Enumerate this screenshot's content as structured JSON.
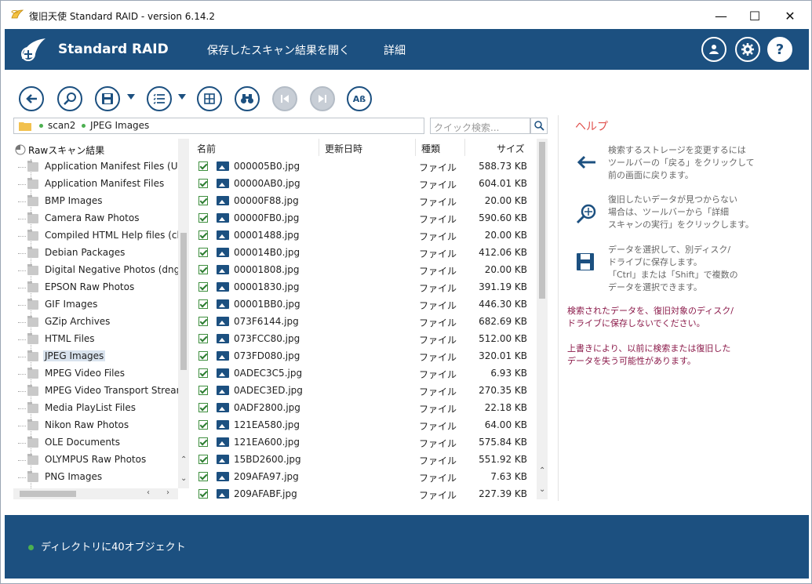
{
  "window": {
    "title": "復旧天使 Standard RAID - version 6.14.2",
    "minimize": "—",
    "maximize": "☐",
    "close": "✕"
  },
  "header": {
    "brand": "Standard RAID",
    "menu": [
      "保存したスキャン結果を開く",
      "詳細"
    ],
    "icons": [
      "user-icon",
      "gear-icon",
      "help-icon"
    ]
  },
  "path": {
    "crumbs": [
      "scan2",
      "JPEG Images"
    ]
  },
  "search": {
    "placeholder": "クイック検索..."
  },
  "tree": {
    "root": "Rawスキャン結果",
    "items": [
      "Application Manifest Files (Un",
      "Application Manifest Files",
      "BMP Images",
      "Camera Raw Photos",
      "Compiled HTML Help files (ch",
      "Debian Packages",
      "Digital Negative Photos (dng)",
      "EPSON Raw Photos",
      "GIF Images",
      "GZip Archives",
      "HTML Files",
      "JPEG Images",
      "MPEG Video Files",
      "MPEG Video Transport Stream",
      "Media PlayList Files",
      "Nikon Raw Photos",
      "OLE Documents",
      "OLYMPUS Raw Photos",
      "PNG Images"
    ],
    "selected": "JPEG Images"
  },
  "list": {
    "columns": [
      "名前",
      "更新日時",
      "種類",
      "サイズ"
    ],
    "rows": [
      {
        "name": "000005B0.jpg",
        "type": "ファイル",
        "size": "588.73 KB"
      },
      {
        "name": "00000AB0.jpg",
        "type": "ファイル",
        "size": "604.01 KB"
      },
      {
        "name": "00000F88.jpg",
        "type": "ファイル",
        "size": "20.00 KB"
      },
      {
        "name": "00000FB0.jpg",
        "type": "ファイル",
        "size": "590.60 KB"
      },
      {
        "name": "00001488.jpg",
        "type": "ファイル",
        "size": "20.00 KB"
      },
      {
        "name": "000014B0.jpg",
        "type": "ファイル",
        "size": "412.06 KB"
      },
      {
        "name": "00001808.jpg",
        "type": "ファイル",
        "size": "20.00 KB"
      },
      {
        "name": "00001830.jpg",
        "type": "ファイル",
        "size": "391.19 KB"
      },
      {
        "name": "00001BB0.jpg",
        "type": "ファイル",
        "size": "446.30 KB"
      },
      {
        "name": "073F6144.jpg",
        "type": "ファイル",
        "size": "682.69 KB"
      },
      {
        "name": "073FCC80.jpg",
        "type": "ファイル",
        "size": "512.00 KB"
      },
      {
        "name": "073FD080.jpg",
        "type": "ファイル",
        "size": "320.01 KB"
      },
      {
        "name": "0ADEC3C5.jpg",
        "type": "ファイル",
        "size": "6.93 KB"
      },
      {
        "name": "0ADEC3ED.jpg",
        "type": "ファイル",
        "size": "270.35 KB"
      },
      {
        "name": "0ADF2800.jpg",
        "type": "ファイル",
        "size": "22.18 KB"
      },
      {
        "name": "121EA580.jpg",
        "type": "ファイル",
        "size": "64.00 KB"
      },
      {
        "name": "121EA600.jpg",
        "type": "ファイル",
        "size": "575.84 KB"
      },
      {
        "name": "15BD2600.jpg",
        "type": "ファイル",
        "size": "551.92 KB"
      },
      {
        "name": "209AFA97.jpg",
        "type": "ファイル",
        "size": "7.63 KB"
      },
      {
        "name": "209AFABF.jpg",
        "type": "ファイル",
        "size": "227.39 KB"
      }
    ]
  },
  "help": {
    "title": "ヘルプ",
    "items": [
      {
        "icon": "back-arrow-icon",
        "lines": [
          "検索するストレージを変更するには",
          "ツールバーの「戻る」をクリックして",
          "前の画面に戻ります。"
        ]
      },
      {
        "icon": "deep-scan-icon",
        "lines": [
          "復旧したいデータが見つからない",
          "場合は、ツールバーから「詳細",
          "スキャンの実行」をクリックします。"
        ]
      },
      {
        "icon": "save-icon",
        "lines": [
          "データを選択して、別ディスク/",
          "ドライブに保存します。",
          "「Ctrl」または「Shift」で複数の",
          "データを選択できます。"
        ]
      }
    ],
    "warnings": [
      [
        "検索されたデータを、復旧対象のディスク/",
        "ドライブに保存しないでください。"
      ],
      [
        "上書きにより、以前に検索または復旧した",
        "データを失う可能性があります。"
      ]
    ]
  },
  "footer": {
    "status": "ディレクトリに40オブジェクト"
  },
  "colors": {
    "brand": "#1c5080",
    "help_title": "#e0504c",
    "warning": "#8b1a4a",
    "status_dot": "#4caf50"
  }
}
